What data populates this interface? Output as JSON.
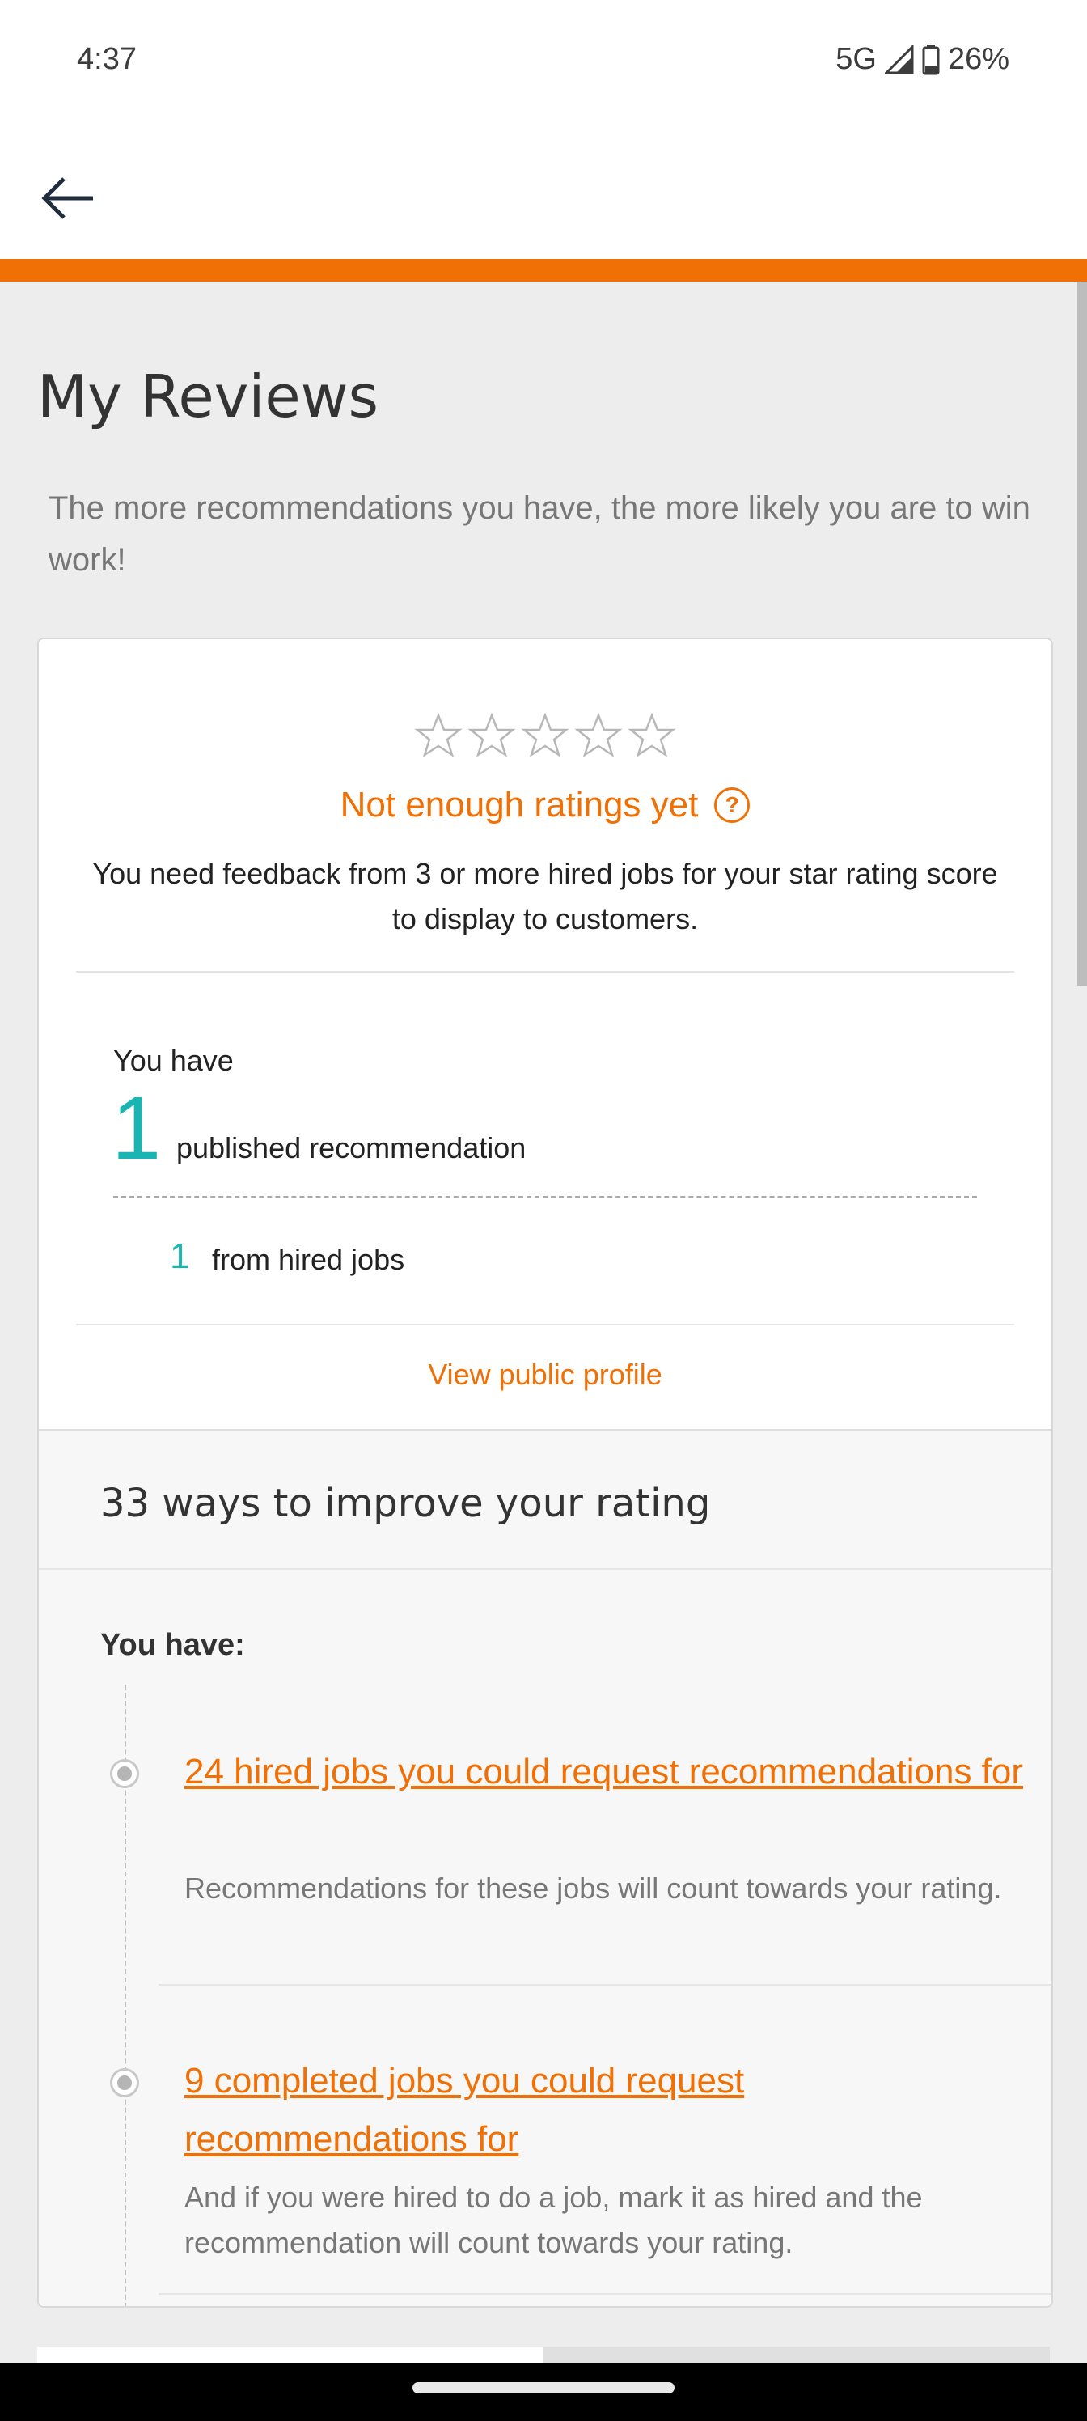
{
  "status_bar": {
    "time": "4:37",
    "network": "5G",
    "battery": "26%"
  },
  "colors": {
    "accent": "#f07006",
    "teal": "#1ab5b2",
    "background": "#ededed"
  },
  "header": {
    "back_icon": "arrow-left-icon"
  },
  "page": {
    "title": "My Reviews",
    "subtitle": "The more recommendations you have, the more likely you are to win work!"
  },
  "rating": {
    "stars_filled": 0,
    "stars_total": 5,
    "status": "Not enough ratings yet",
    "help_icon": "?",
    "note": "You need feedback from 3 or more hired jobs for your star rating score to display to customers."
  },
  "recommendations": {
    "intro": "You have",
    "count": "1",
    "label": "published recommendation",
    "hired_count": "1",
    "hired_label": "from hired jobs",
    "view_profile": "View public profile"
  },
  "improve": {
    "title": "33 ways to improve your rating",
    "you_have": "You have:",
    "items": [
      {
        "link": "24 hired jobs you could request recommendations for",
        "desc": "Recommendations for these jobs will count towards your rating."
      },
      {
        "link": "9 completed jobs you could request recommendations for",
        "desc": "And if you were hired to do a job, mark it as hired and the recommendation will count towards your rating."
      }
    ]
  }
}
